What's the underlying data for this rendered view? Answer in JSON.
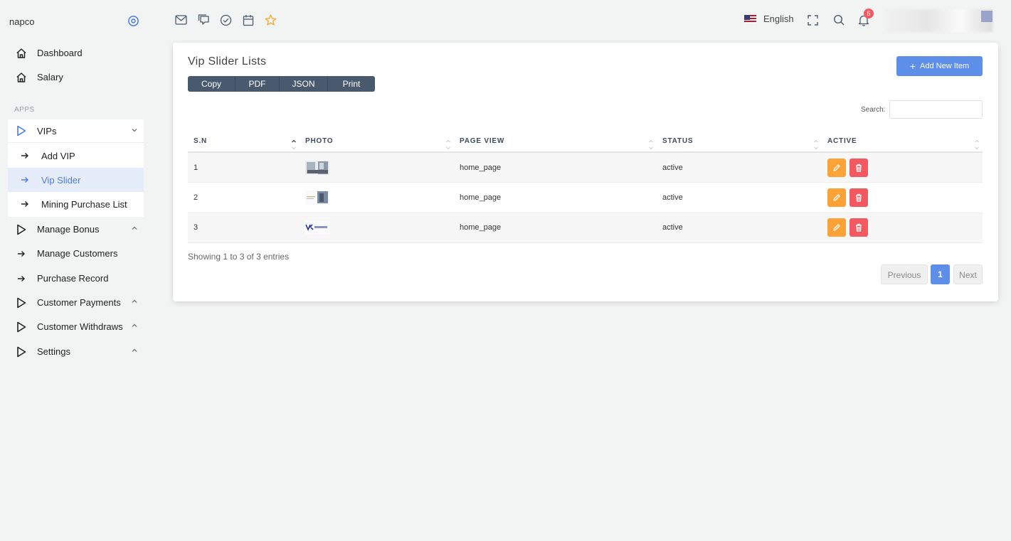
{
  "app": {
    "brand": "napco"
  },
  "sidebar": {
    "items_top": [
      {
        "label": "Dashboard",
        "icon": "home-icon"
      },
      {
        "label": "Salary",
        "icon": "home-icon"
      }
    ],
    "section_label": "APPS",
    "vips": {
      "label": "VIPs",
      "icon": "play-icon"
    },
    "vip_sub": [
      {
        "label": "Add VIP"
      },
      {
        "label": "Vip Slider",
        "active": true
      },
      {
        "label": "Mining Purchase List"
      }
    ],
    "items_bottom": [
      {
        "label": "Manage Bonus",
        "icon": "play-icon",
        "chevron": "up"
      },
      {
        "label": "Manage Customers",
        "icon": "arrow-right-icon"
      },
      {
        "label": "Purchase Record",
        "icon": "arrow-right-icon"
      },
      {
        "label": "Customer Payments",
        "icon": "play-icon",
        "chevron": "up"
      },
      {
        "label": "Customer Withdraws",
        "icon": "play-icon",
        "chevron": "up"
      },
      {
        "label": "Settings",
        "icon": "play-icon",
        "chevron": "up"
      }
    ]
  },
  "topbar": {
    "language": "English",
    "notification_count": "5"
  },
  "card": {
    "title": "Vip Slider Lists",
    "export_buttons": [
      "Copy",
      "PDF",
      "JSON",
      "Print"
    ],
    "add_button": "Add New Item",
    "search_label": "Search:",
    "columns": [
      "S.N",
      "PHOTO",
      "PAGE VIEW",
      "STATUS",
      "ACTIVE"
    ],
    "rows": [
      {
        "sn": "1",
        "page_view": "home_page",
        "status": "active"
      },
      {
        "sn": "2",
        "page_view": "home_page",
        "status": "active"
      },
      {
        "sn": "3",
        "page_view": "home_page",
        "status": "active"
      }
    ],
    "info": "Showing 1 to 3 of 3 entries",
    "pagination": {
      "prev": "Previous",
      "page": "1",
      "next": "Next"
    }
  },
  "colors": {
    "primary": "#5d8ee8",
    "edit": "#fca237",
    "delete": "#f25961",
    "export_group": "#4a5a6e"
  }
}
